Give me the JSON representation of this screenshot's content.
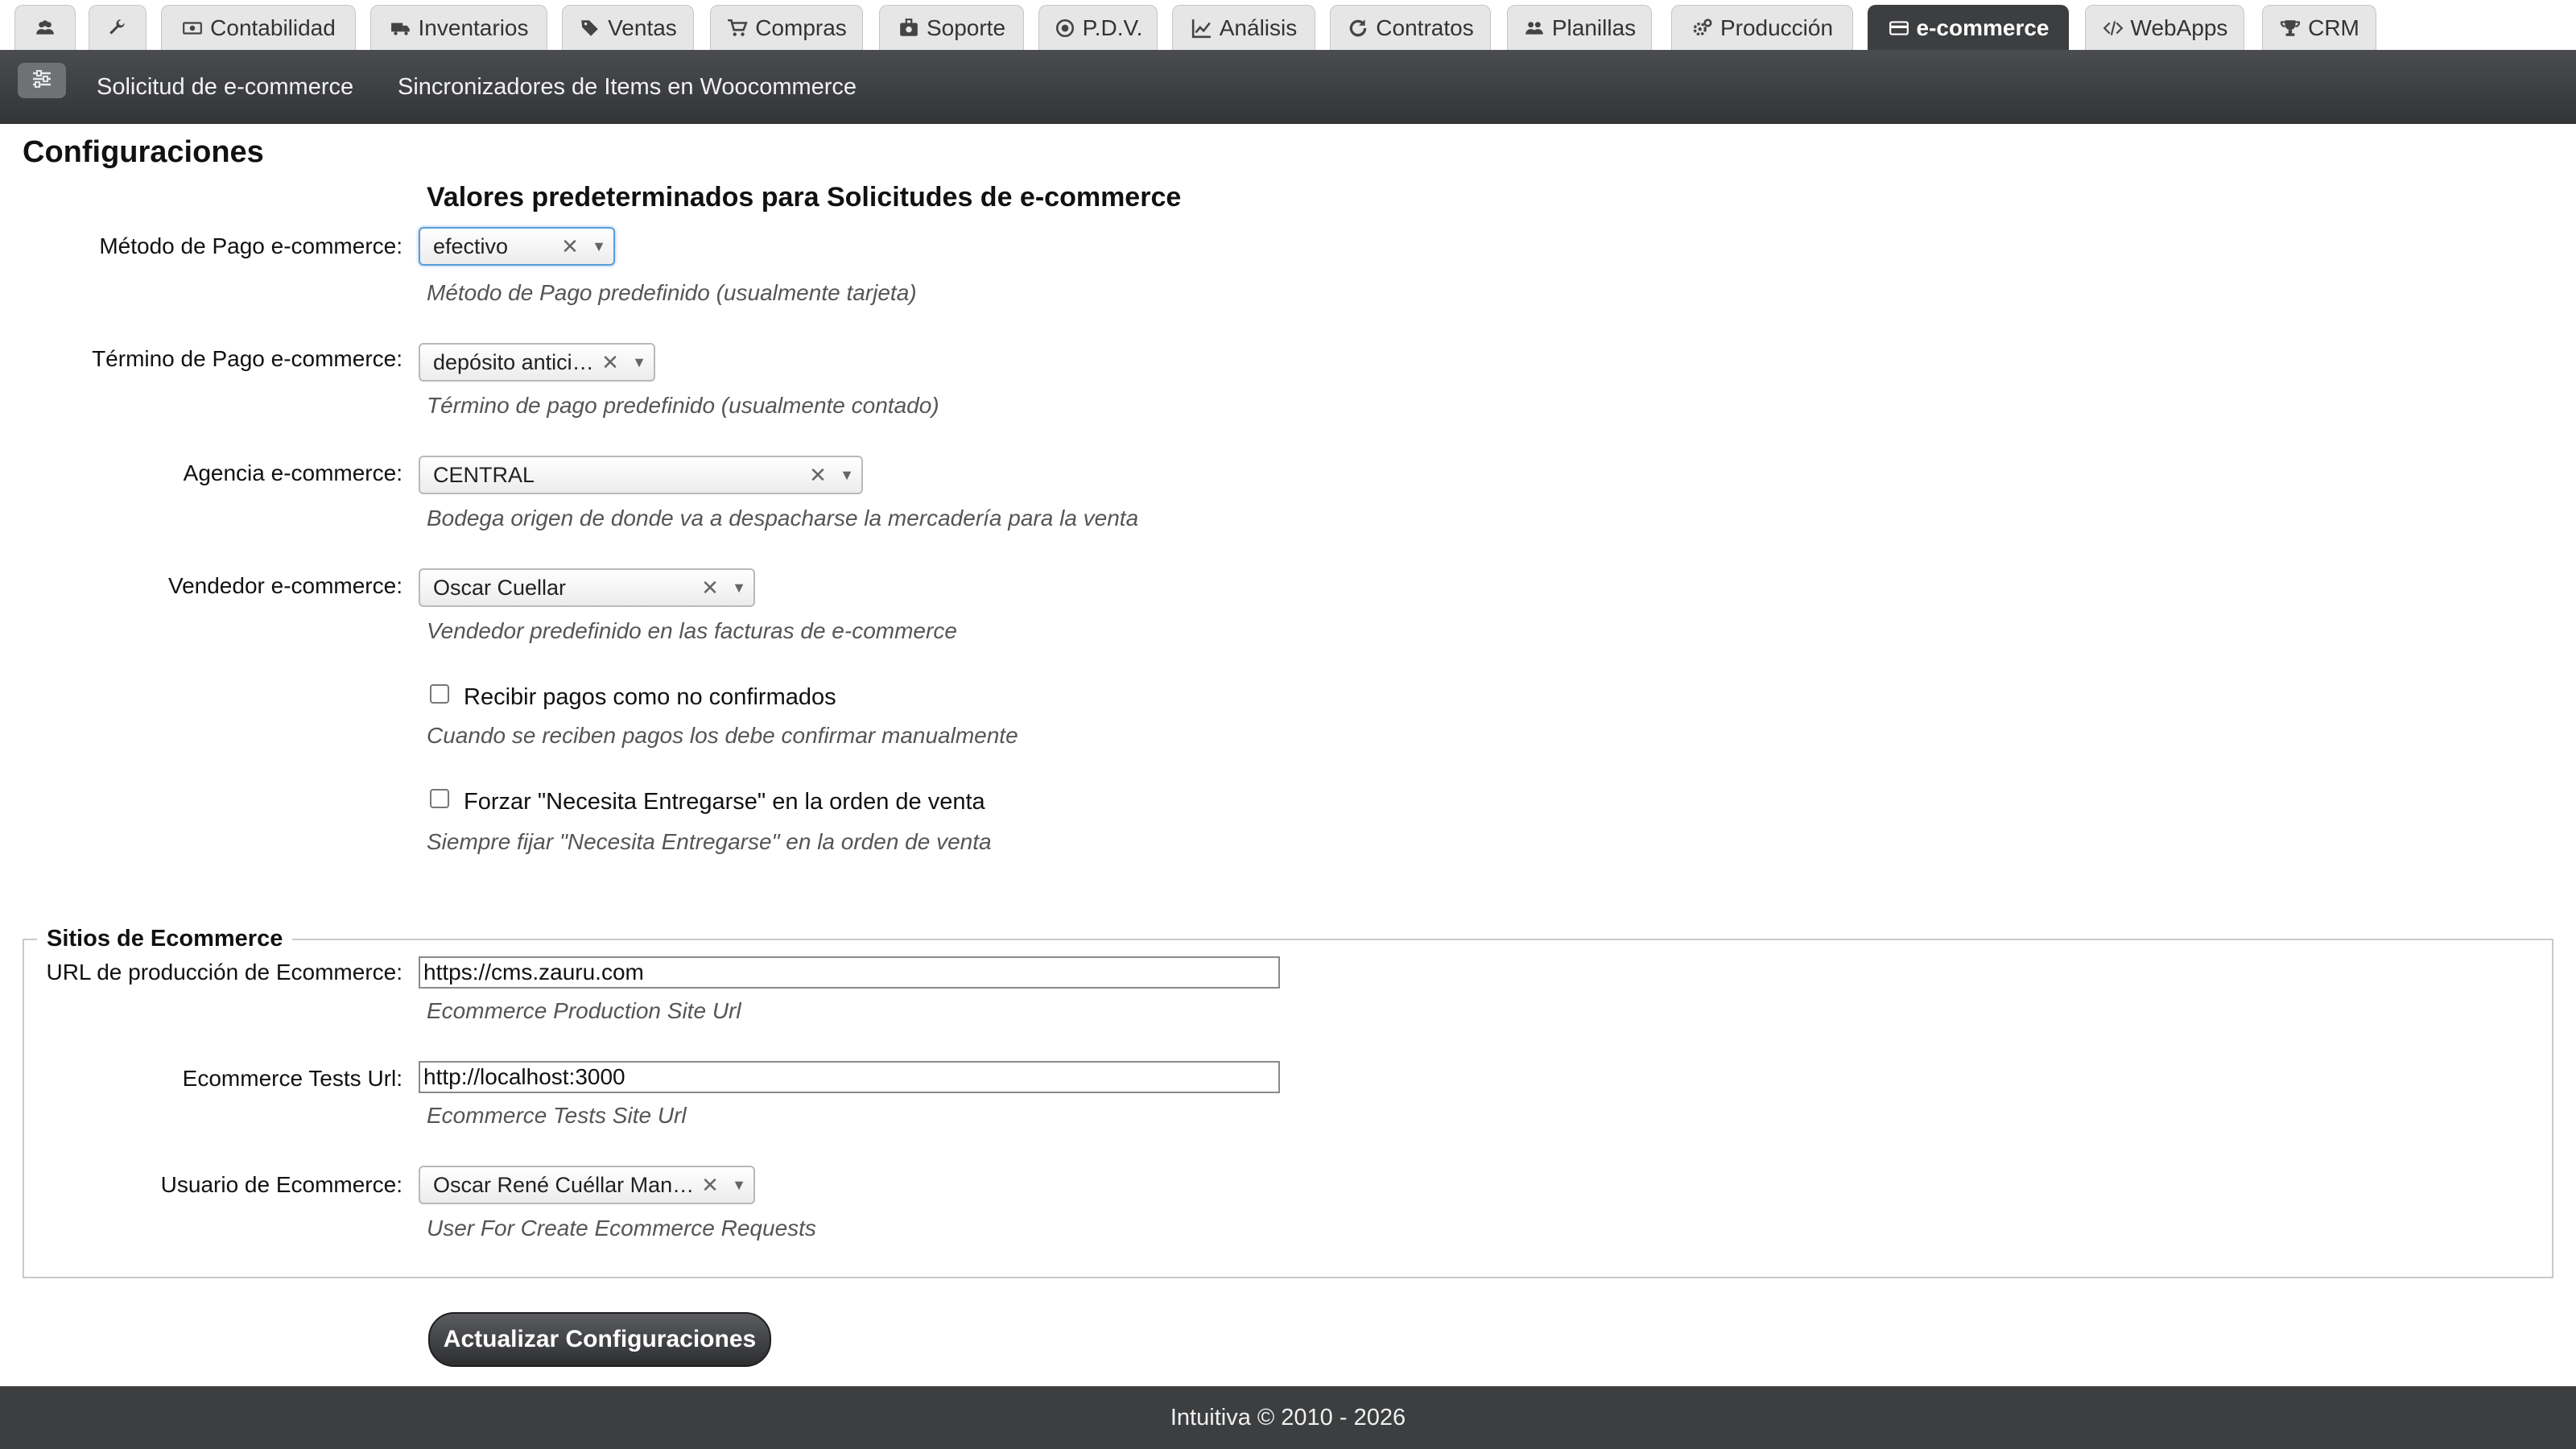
{
  "tabs": [
    {
      "label": "",
      "icon": "users-icon"
    },
    {
      "label": "",
      "icon": "wrench-icon"
    },
    {
      "label": "Contabilidad",
      "icon": "money-icon"
    },
    {
      "label": "Inventarios",
      "icon": "truck-icon"
    },
    {
      "label": "Ventas",
      "icon": "tags-icon"
    },
    {
      "label": "Compras",
      "icon": "cart-icon"
    },
    {
      "label": "Soporte",
      "icon": "medkit-icon"
    },
    {
      "label": "P.D.V.",
      "icon": "target-icon"
    },
    {
      "label": "Análisis",
      "icon": "line-chart-icon"
    },
    {
      "label": "Contratos",
      "icon": "refresh-icon"
    },
    {
      "label": "Planillas",
      "icon": "users-icon"
    },
    {
      "label": "Producción",
      "icon": "cogs-icon"
    },
    {
      "label": "e-commerce",
      "icon": "credit-card-icon",
      "active": true
    },
    {
      "label": "WebApps",
      "icon": "code-icon"
    },
    {
      "label": "CRM",
      "icon": "trophy-icon"
    }
  ],
  "subnav": {
    "items": [
      "Solicitud de e-commerce",
      "Sincronizadores de Items en Woocommerce"
    ]
  },
  "page": {
    "title": "Configuraciones",
    "section_title": "Valores predeterminados para Solicitudes de e-commerce"
  },
  "fields": {
    "payment_method": {
      "label": "Método de Pago e-commerce:",
      "value": "efectivo",
      "hint": "Método de Pago predefinido (usualmente tarjeta)"
    },
    "payment_term": {
      "label": "Término de Pago e-commerce:",
      "value": "depósito anticipado",
      "hint": "Término de pago predefinido (usualmente contado)"
    },
    "agency": {
      "label": "Agencia e-commerce:",
      "value": "CENTRAL",
      "hint": "Bodega origen de donde va a despacharse la mercadería para la venta"
    },
    "seller": {
      "label": "Vendedor e-commerce:",
      "value": "Oscar Cuellar",
      "hint": "Vendedor predefinido en las facturas de e-commerce"
    },
    "unconfirmed_payments": {
      "label": "Recibir pagos como no confirmados",
      "checked": false,
      "hint": "Cuando se reciben pagos los debe confirmar manualmente"
    },
    "force_delivery": {
      "label": "Forzar \"Necesita Entregarse\" en la orden de venta",
      "checked": false,
      "hint": "Siempre fijar \"Necesita Entregarse\" en la orden de venta"
    }
  },
  "sites": {
    "legend": "Sitios de Ecommerce",
    "production_url": {
      "label": "URL de producción de Ecommerce:",
      "value": "https://cms.zauru.com",
      "hint": "Ecommerce Production Site Url"
    },
    "tests_url": {
      "label": "Ecommerce Tests Url:",
      "value": "http://localhost:3000",
      "hint": "Ecommerce Tests Site Url"
    },
    "user": {
      "label": "Usuario de Ecommerce:",
      "value": "Oscar René Cuéllar Mancilla",
      "hint": "User For Create Ecommerce Requests"
    }
  },
  "submit_label": "Actualizar Configuraciones",
  "footer": "Intuitiva © 2010 - 2026",
  "glyphs": {
    "clear": "✕",
    "arrow": "▼"
  },
  "colors": {
    "active_tab": "#3c3e40",
    "subnav": "#3f4143",
    "footer": "#3c3e40",
    "focus": "#5b9dd9"
  }
}
